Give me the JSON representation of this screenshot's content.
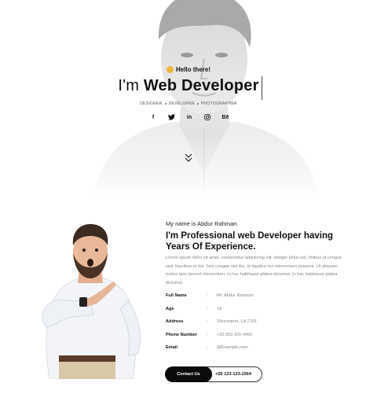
{
  "hero": {
    "greeting": "Hello there!",
    "headline_prefix": "I'm ",
    "headline_role": "Web Developer",
    "roles": [
      "DESIGNER",
      "DEVELOPER",
      "PHOTOGRAPHER"
    ],
    "socials": [
      {
        "icon": "facebook-icon",
        "glyph": "f"
      },
      {
        "icon": "twitter-icon",
        "glyph": ""
      },
      {
        "icon": "linkedin-icon",
        "glyph": "in"
      },
      {
        "icon": "instagram-icon",
        "glyph": ""
      },
      {
        "icon": "behance-icon",
        "glyph": "Bē"
      }
    ]
  },
  "about": {
    "intro": "My name is Abdur Rahman.",
    "title": "I'm Professional web Developer having Years Of Experience.",
    "paragraph": "Lorem ipsum dolor sit amet, consectetur adipiscing elit. Integer tellus est, finibus ut congue sed, faucibus ut dui. Sed congue nisl dui, id dapibus leo elementum posuere. Ut aliquam metus quis laoreet elementum. In hac habitasse platea dictumst. In hac habitasse platea dictumst.",
    "info": [
      {
        "key": "Full Name",
        "value": "Mr. Abdur Rahman"
      },
      {
        "key": "Age",
        "value": "18"
      },
      {
        "key": "Address",
        "value": "Shreveport, LA 7101"
      },
      {
        "key": "Phone Number",
        "value": "+20 253 265 4455"
      },
      {
        "key": "Email",
        "value": "@Example.com"
      }
    ],
    "separator": ":",
    "contact_label": "Contact Us",
    "phone_label": "+00 123-123-1564"
  },
  "colors": {
    "accent": "#0b0b0b",
    "wave": "#f0b43c",
    "muted_text": "#888888"
  }
}
